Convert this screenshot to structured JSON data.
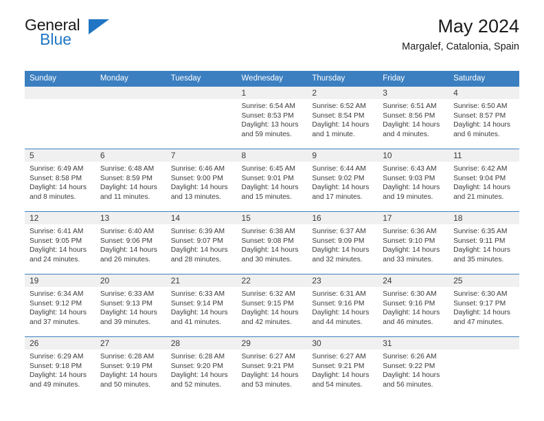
{
  "brand": {
    "name_top": "General",
    "name_bottom": "Blue"
  },
  "header": {
    "title": "May 2024",
    "subtitle": "Margalef, Catalonia, Spain"
  },
  "colors": {
    "header_blue": "#3b7fc0",
    "brand_blue": "#2076c4",
    "daynum_bg": "#f0f0f0"
  },
  "weekday_headers": [
    "Sunday",
    "Monday",
    "Tuesday",
    "Wednesday",
    "Thursday",
    "Friday",
    "Saturday"
  ],
  "labels": {
    "sunrise": "Sunrise:",
    "sunset": "Sunset:",
    "daylight": "Daylight:"
  },
  "weeks": [
    [
      {
        "day": ""
      },
      {
        "day": ""
      },
      {
        "day": ""
      },
      {
        "day": "1",
        "sunrise": "Sunrise: 6:54 AM",
        "sunset": "Sunset: 8:53 PM",
        "daylight": "Daylight: 13 hours and 59 minutes."
      },
      {
        "day": "2",
        "sunrise": "Sunrise: 6:52 AM",
        "sunset": "Sunset: 8:54 PM",
        "daylight": "Daylight: 14 hours and 1 minute."
      },
      {
        "day": "3",
        "sunrise": "Sunrise: 6:51 AM",
        "sunset": "Sunset: 8:56 PM",
        "daylight": "Daylight: 14 hours and 4 minutes."
      },
      {
        "day": "4",
        "sunrise": "Sunrise: 6:50 AM",
        "sunset": "Sunset: 8:57 PM",
        "daylight": "Daylight: 14 hours and 6 minutes."
      }
    ],
    [
      {
        "day": "5",
        "sunrise": "Sunrise: 6:49 AM",
        "sunset": "Sunset: 8:58 PM",
        "daylight": "Daylight: 14 hours and 8 minutes."
      },
      {
        "day": "6",
        "sunrise": "Sunrise: 6:48 AM",
        "sunset": "Sunset: 8:59 PM",
        "daylight": "Daylight: 14 hours and 11 minutes."
      },
      {
        "day": "7",
        "sunrise": "Sunrise: 6:46 AM",
        "sunset": "Sunset: 9:00 PM",
        "daylight": "Daylight: 14 hours and 13 minutes."
      },
      {
        "day": "8",
        "sunrise": "Sunrise: 6:45 AM",
        "sunset": "Sunset: 9:01 PM",
        "daylight": "Daylight: 14 hours and 15 minutes."
      },
      {
        "day": "9",
        "sunrise": "Sunrise: 6:44 AM",
        "sunset": "Sunset: 9:02 PM",
        "daylight": "Daylight: 14 hours and 17 minutes."
      },
      {
        "day": "10",
        "sunrise": "Sunrise: 6:43 AM",
        "sunset": "Sunset: 9:03 PM",
        "daylight": "Daylight: 14 hours and 19 minutes."
      },
      {
        "day": "11",
        "sunrise": "Sunrise: 6:42 AM",
        "sunset": "Sunset: 9:04 PM",
        "daylight": "Daylight: 14 hours and 21 minutes."
      }
    ],
    [
      {
        "day": "12",
        "sunrise": "Sunrise: 6:41 AM",
        "sunset": "Sunset: 9:05 PM",
        "daylight": "Daylight: 14 hours and 24 minutes."
      },
      {
        "day": "13",
        "sunrise": "Sunrise: 6:40 AM",
        "sunset": "Sunset: 9:06 PM",
        "daylight": "Daylight: 14 hours and 26 minutes."
      },
      {
        "day": "14",
        "sunrise": "Sunrise: 6:39 AM",
        "sunset": "Sunset: 9:07 PM",
        "daylight": "Daylight: 14 hours and 28 minutes."
      },
      {
        "day": "15",
        "sunrise": "Sunrise: 6:38 AM",
        "sunset": "Sunset: 9:08 PM",
        "daylight": "Daylight: 14 hours and 30 minutes."
      },
      {
        "day": "16",
        "sunrise": "Sunrise: 6:37 AM",
        "sunset": "Sunset: 9:09 PM",
        "daylight": "Daylight: 14 hours and 32 minutes."
      },
      {
        "day": "17",
        "sunrise": "Sunrise: 6:36 AM",
        "sunset": "Sunset: 9:10 PM",
        "daylight": "Daylight: 14 hours and 33 minutes."
      },
      {
        "day": "18",
        "sunrise": "Sunrise: 6:35 AM",
        "sunset": "Sunset: 9:11 PM",
        "daylight": "Daylight: 14 hours and 35 minutes."
      }
    ],
    [
      {
        "day": "19",
        "sunrise": "Sunrise: 6:34 AM",
        "sunset": "Sunset: 9:12 PM",
        "daylight": "Daylight: 14 hours and 37 minutes."
      },
      {
        "day": "20",
        "sunrise": "Sunrise: 6:33 AM",
        "sunset": "Sunset: 9:13 PM",
        "daylight": "Daylight: 14 hours and 39 minutes."
      },
      {
        "day": "21",
        "sunrise": "Sunrise: 6:33 AM",
        "sunset": "Sunset: 9:14 PM",
        "daylight": "Daylight: 14 hours and 41 minutes."
      },
      {
        "day": "22",
        "sunrise": "Sunrise: 6:32 AM",
        "sunset": "Sunset: 9:15 PM",
        "daylight": "Daylight: 14 hours and 42 minutes."
      },
      {
        "day": "23",
        "sunrise": "Sunrise: 6:31 AM",
        "sunset": "Sunset: 9:16 PM",
        "daylight": "Daylight: 14 hours and 44 minutes."
      },
      {
        "day": "24",
        "sunrise": "Sunrise: 6:30 AM",
        "sunset": "Sunset: 9:16 PM",
        "daylight": "Daylight: 14 hours and 46 minutes."
      },
      {
        "day": "25",
        "sunrise": "Sunrise: 6:30 AM",
        "sunset": "Sunset: 9:17 PM",
        "daylight": "Daylight: 14 hours and 47 minutes."
      }
    ],
    [
      {
        "day": "26",
        "sunrise": "Sunrise: 6:29 AM",
        "sunset": "Sunset: 9:18 PM",
        "daylight": "Daylight: 14 hours and 49 minutes."
      },
      {
        "day": "27",
        "sunrise": "Sunrise: 6:28 AM",
        "sunset": "Sunset: 9:19 PM",
        "daylight": "Daylight: 14 hours and 50 minutes."
      },
      {
        "day": "28",
        "sunrise": "Sunrise: 6:28 AM",
        "sunset": "Sunset: 9:20 PM",
        "daylight": "Daylight: 14 hours and 52 minutes."
      },
      {
        "day": "29",
        "sunrise": "Sunrise: 6:27 AM",
        "sunset": "Sunset: 9:21 PM",
        "daylight": "Daylight: 14 hours and 53 minutes."
      },
      {
        "day": "30",
        "sunrise": "Sunrise: 6:27 AM",
        "sunset": "Sunset: 9:21 PM",
        "daylight": "Daylight: 14 hours and 54 minutes."
      },
      {
        "day": "31",
        "sunrise": "Sunrise: 6:26 AM",
        "sunset": "Sunset: 9:22 PM",
        "daylight": "Daylight: 14 hours and 56 minutes."
      },
      {
        "day": ""
      }
    ]
  ]
}
